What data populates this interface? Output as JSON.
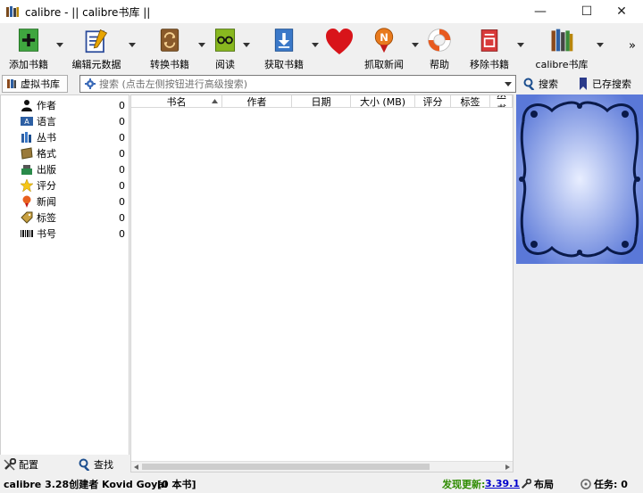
{
  "window": {
    "title": "calibre - || calibre书库 ||"
  },
  "toolbar": {
    "add": "添加书籍",
    "edit": "编辑元数据",
    "convert": "转换书籍",
    "read": "阅读",
    "get": "获取书籍",
    "fetch_news": "抓取新闻",
    "help": "帮助",
    "remove": "移除书籍",
    "library": "calibre书库",
    "more": "»"
  },
  "searchbar": {
    "virtual_library": "虚拟书库",
    "placeholder": "搜索 (点击左侧按钮进行高级搜索)",
    "search_btn": "搜索",
    "saved_btn": "已存搜索"
  },
  "categories": [
    {
      "label": "作者",
      "count": "0",
      "icon": "person-icon"
    },
    {
      "label": "语言",
      "count": "0",
      "icon": "language-icon"
    },
    {
      "label": "丛书",
      "count": "0",
      "icon": "series-icon"
    },
    {
      "label": "格式",
      "count": "0",
      "icon": "format-icon"
    },
    {
      "label": "出版",
      "count": "0",
      "icon": "publisher-icon"
    },
    {
      "label": "评分",
      "count": "0",
      "icon": "star-icon"
    },
    {
      "label": "新闻",
      "count": "0",
      "icon": "news-icon"
    },
    {
      "label": "标签",
      "count": "0",
      "icon": "tag-icon"
    },
    {
      "label": "书号",
      "count": "0",
      "icon": "barcode-icon"
    }
  ],
  "columns": [
    "书名",
    "作者",
    "日期",
    "大小 (MB)",
    "评分",
    "标签",
    "丛书"
  ],
  "bottom_left": {
    "configure": "配置",
    "find": "查找"
  },
  "status": {
    "version": "calibre 3.28创建者 Kovid Goyal",
    "books": "[0 本书]",
    "update_label": "发现更新:",
    "update_version": "3.39.1",
    "layout": "布局",
    "jobs": "任务: 0"
  },
  "colors": {
    "cover_blue": "#6a86dd",
    "update_green": "#2e8b00",
    "link_blue": "#0000cc"
  }
}
